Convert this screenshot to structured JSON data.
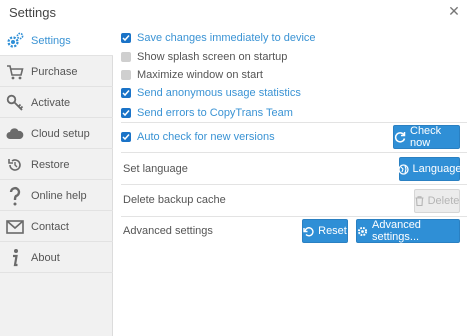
{
  "window": {
    "title": "Settings",
    "close_glyph": "✕"
  },
  "sidebar": {
    "items": [
      {
        "label": "Settings",
        "icon": "gear-icon",
        "active": true
      },
      {
        "label": "Purchase",
        "icon": "cart-icon",
        "active": false
      },
      {
        "label": "Activate",
        "icon": "key-icon",
        "active": false
      },
      {
        "label": "Cloud setup",
        "icon": "cloud-icon",
        "active": false
      },
      {
        "label": "Restore",
        "icon": "restore-icon",
        "active": false
      },
      {
        "label": "Online help",
        "icon": "question-icon",
        "active": false
      },
      {
        "label": "Contact",
        "icon": "envelope-icon",
        "active": false
      },
      {
        "label": "About",
        "icon": "info-icon",
        "active": false
      }
    ]
  },
  "options": [
    {
      "label": "Save changes immediately to device",
      "checked": true
    },
    {
      "label": "Show splash screen on startup",
      "checked": false
    },
    {
      "label": "Maximize window on start",
      "checked": false
    },
    {
      "label": "Send anonymous usage statistics",
      "checked": true
    },
    {
      "label": "Send errors to CopyTrans Team",
      "checked": true
    }
  ],
  "auto_check": {
    "label": "Auto check for new versions",
    "checked": true,
    "button": "Check now"
  },
  "language": {
    "label": "Set language",
    "button": "Language"
  },
  "backup": {
    "label": "Delete backup cache",
    "button": "Delete"
  },
  "advanced": {
    "label": "Advanced settings",
    "reset_button": "Reset",
    "advanced_button": "Advanced settings..."
  },
  "colors": {
    "accent": "#2f8fd6",
    "link_blue": "#3a93d4",
    "checkbox_on": "#1a73c7"
  }
}
